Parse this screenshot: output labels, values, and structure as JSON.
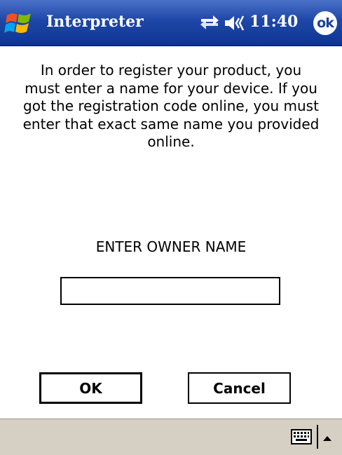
{
  "titlebar": {
    "app_title": "Interpreter",
    "time": "11:40",
    "ok_label": "ok",
    "start_icon": "windows-flag-icon",
    "connectivity_icon": "sync-arrows-icon",
    "volume_icon": "speaker-icon",
    "background_color": "#1e47a8"
  },
  "dialog": {
    "message": "In order to register your product, you must enter a name for your device. If you got the registration code online, you must enter that exact same name you provided online.",
    "field_label": "ENTER OWNER NAME",
    "owner_name_value": "",
    "ok_button": "OK",
    "cancel_button": "Cancel"
  },
  "menubar": {
    "keyboard_icon": "keyboard-icon",
    "arrow_icon": "caret-up-icon",
    "background_color": "#d6cfc4"
  }
}
